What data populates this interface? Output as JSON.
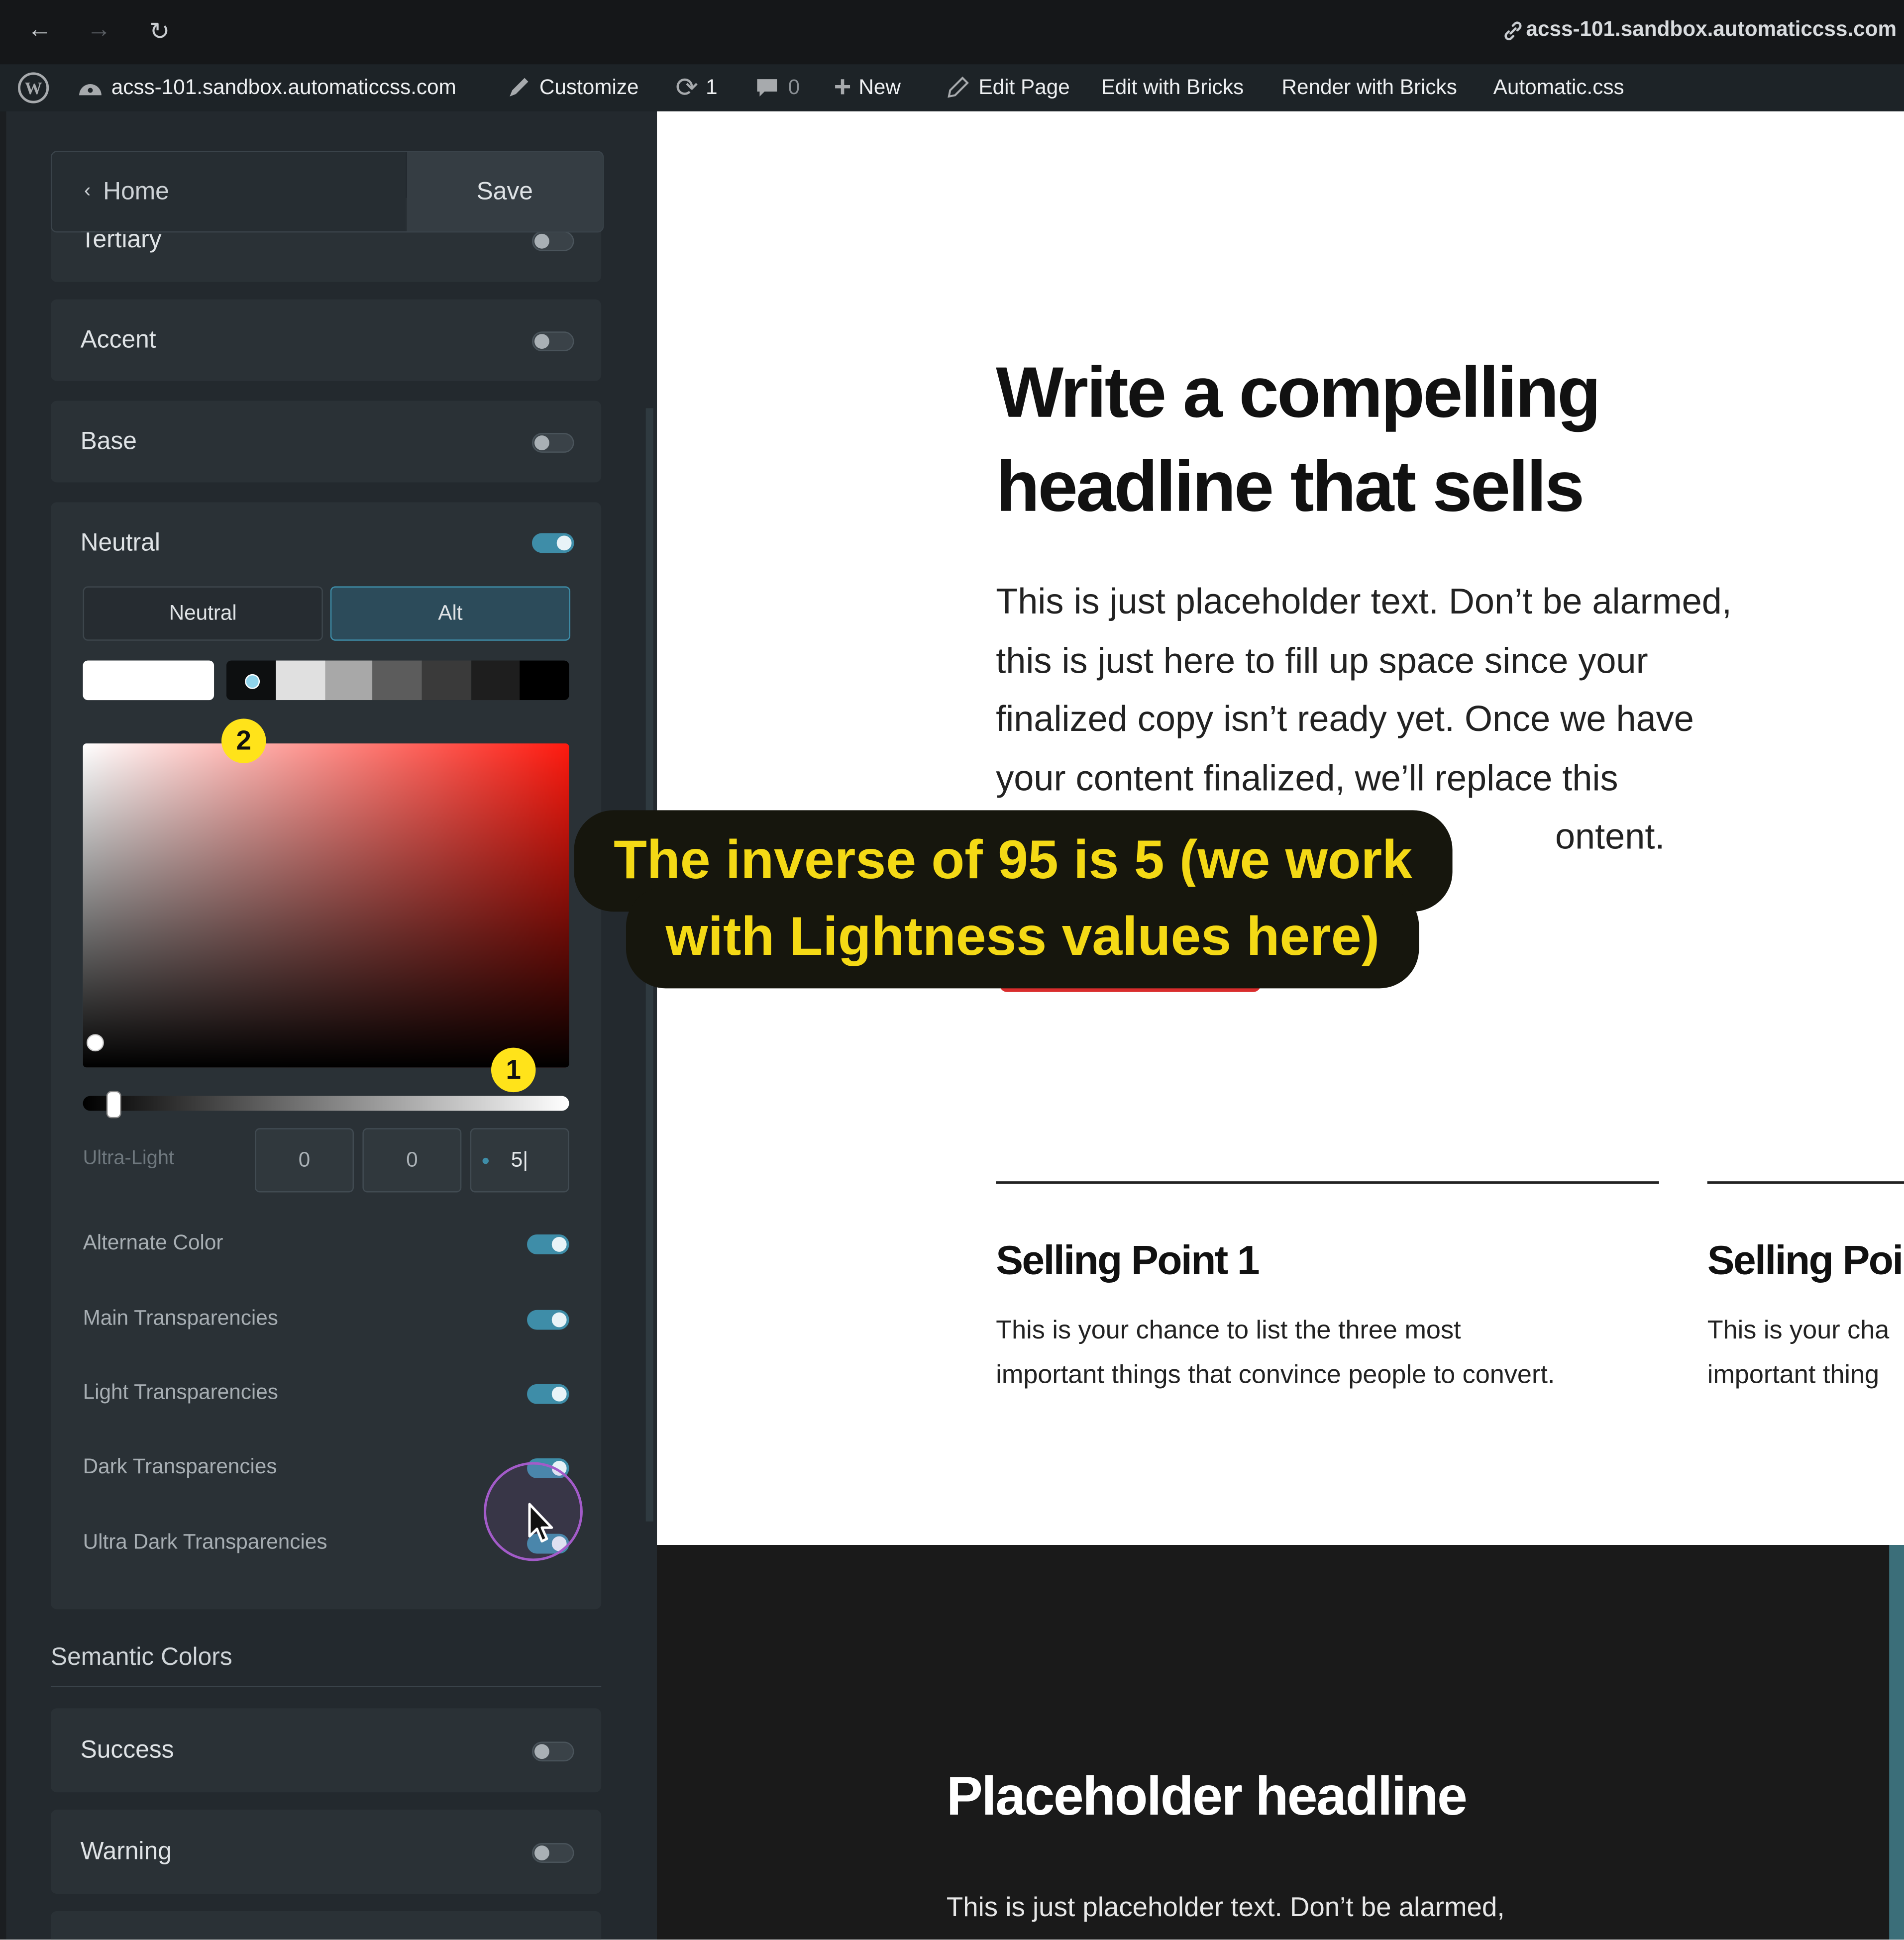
{
  "browser": {
    "url": "acss-101.sandbox.automaticcss.com"
  },
  "admin_bar": {
    "site_name": "acss-101.sandbox.automaticcss.com",
    "customize": "Customize",
    "updates_count": "1",
    "comments_count": "0",
    "new": "New",
    "edit_page": "Edit Page",
    "edit_with_bricks": "Edit with Bricks",
    "render_with_bricks": "Render with Bricks",
    "automatic_css": "Automatic.css"
  },
  "panel": {
    "home_label": "Home",
    "save_label": "Save",
    "color_rows": [
      {
        "label": "Tertiary",
        "enabled": false
      },
      {
        "label": "Accent",
        "enabled": false
      },
      {
        "label": "Base",
        "enabled": false
      }
    ],
    "neutral": {
      "label": "Neutral",
      "enabled": true,
      "tabs": [
        "Neutral",
        "Alt"
      ],
      "active_tab": "Alt",
      "shade_colors": [
        "#e0e0e0",
        "#a8a8a8",
        "#5c5c5c",
        "#3a3a3a",
        "#1e1e1e",
        "#000000"
      ],
      "picker_hue_color": "#ff1a0f",
      "shade_name": "Ultra-Light",
      "values": [
        "0",
        "0",
        "5"
      ],
      "options": [
        {
          "label": "Alternate Color",
          "enabled": true
        },
        {
          "label": "Main Transparencies",
          "enabled": true
        },
        {
          "label": "Light Transparencies",
          "enabled": true
        },
        {
          "label": "Dark Transparencies",
          "enabled": true
        },
        {
          "label": "Ultra Dark Transparencies",
          "enabled": true
        }
      ]
    },
    "semantic_title": "Semantic Colors",
    "semantic_rows": [
      {
        "label": "Success",
        "enabled": false
      },
      {
        "label": "Warning",
        "enabled": false
      }
    ]
  },
  "annotations": {
    "badge_1": "1",
    "badge_2": "2",
    "badge_color": "#ffe31a"
  },
  "page": {
    "headline_line1": "Write a compelling",
    "headline_line2": "headline that sells",
    "intro_lines": [
      "This is just placeholder text. Don’t be alarmed,",
      "this is just here to fill up space since your",
      "finalized copy isn’t ready yet. Once we have",
      "your content finalized, we’ll replace this",
      "ontent."
    ],
    "selling_points": [
      {
        "title": "Selling Point 1",
        "line1": "This is your chance to list the three most",
        "line2": "important things that convince people to convert."
      },
      {
        "title": "Selling Poi",
        "line1": "This is your cha",
        "line2": "important thing"
      }
    ],
    "dark_headline": "Placeholder headline",
    "dark_text": "This is just placeholder text. Don’t be alarmed,",
    "accent_color": "#d92d2d"
  },
  "caption": {
    "line1": "The inverse of 95 is 5 (we work",
    "line2": "with Lightness values here)",
    "text_color": "#f4d915"
  }
}
